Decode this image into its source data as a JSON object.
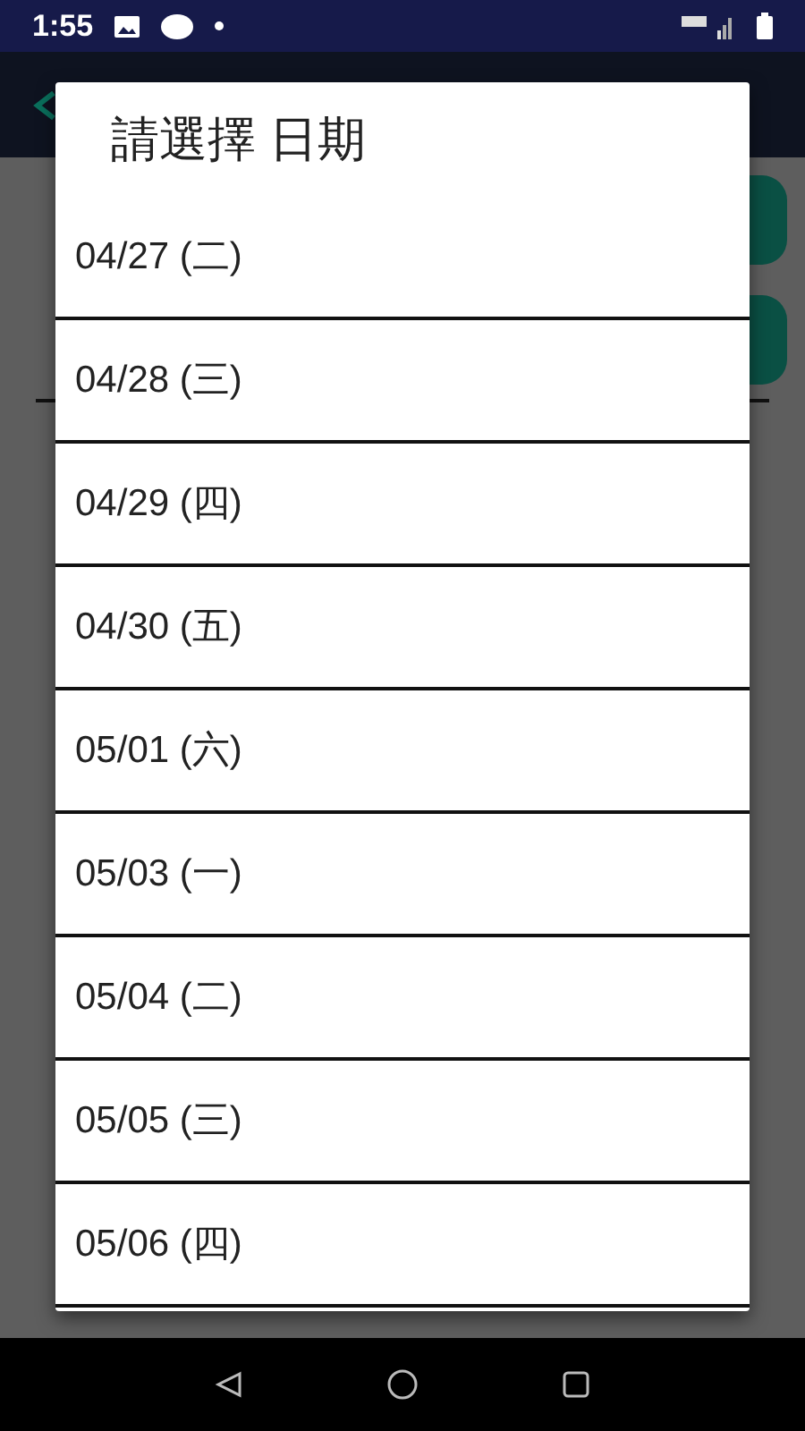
{
  "status_bar": {
    "time": "1:55"
  },
  "dialog": {
    "title": "請選擇 日期",
    "items": [
      {
        "label": "04/27 (二)"
      },
      {
        "label": "04/28 (三)"
      },
      {
        "label": "04/29 (四)"
      },
      {
        "label": "04/30 (五)"
      },
      {
        "label": "05/01 (六)"
      },
      {
        "label": "05/03 (一)"
      },
      {
        "label": "05/04 (二)"
      },
      {
        "label": "05/05 (三)"
      },
      {
        "label": "05/06 (四)"
      }
    ]
  }
}
